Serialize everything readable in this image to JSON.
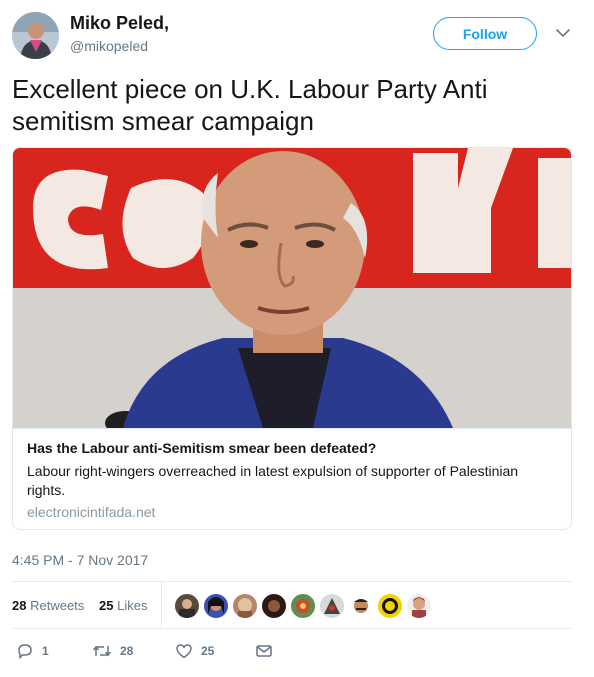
{
  "user": {
    "display_name": "Miko Peled,",
    "handle": "@mikopeled",
    "avatar_icon": "user-avatar"
  },
  "follow_label": "Follow",
  "tweet_text": "Excellent piece on U.K. Labour Party Anti semitism smear campaign",
  "card": {
    "title": "Has the Labour anti-Semitism smear been defeated?",
    "description": "Labour right-wingers overreached in latest expulsion of supporter of Palestinian rights.",
    "domain": "electronicintifada.net"
  },
  "timestamp": "4:45 PM - 7 Nov 2017",
  "stats": {
    "retweets_count": "28",
    "retweets_label": "Retweets",
    "likes_count": "25",
    "likes_label": "Likes"
  },
  "actions": {
    "reply_count": "1",
    "retweet_count": "28",
    "like_count": "25"
  },
  "colors": {
    "accent": "#1da1f2",
    "text": "#14171a",
    "muted": "#657786",
    "banner_red": "#d8261f"
  }
}
